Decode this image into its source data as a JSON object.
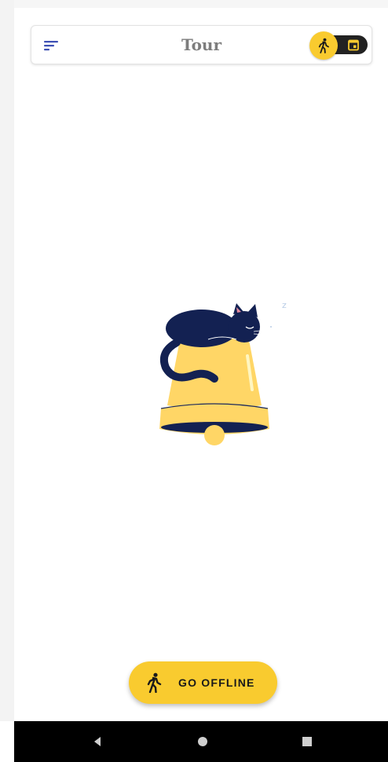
{
  "header": {
    "title": "Tour",
    "menu_icon": "sort-menu-icon",
    "mode_toggle": {
      "selected": "walking-icon",
      "other": "calendar-icon"
    }
  },
  "main": {
    "illustration": "sleeping-cat-on-bell"
  },
  "fab": {
    "label": "GO OFFLINE",
    "icon": "walking-icon"
  },
  "navbar": {
    "buttons": [
      "back-icon",
      "home-icon",
      "recents-icon"
    ]
  },
  "colors": {
    "accent_yellow": "#f9cb2f",
    "menu_blue": "#3f51b5",
    "cat_navy": "#132152",
    "title_gray": "#7d7d7d",
    "navbar": "#000000"
  }
}
